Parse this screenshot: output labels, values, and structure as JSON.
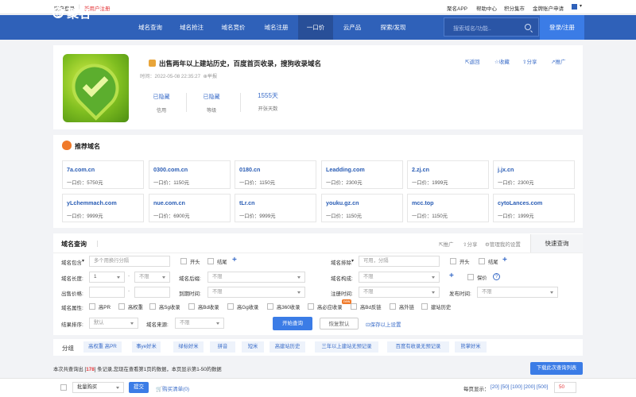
{
  "topbar": {
    "login": "账户登录",
    "register": "新用户注册",
    "app": "聚名APP",
    "help": "帮助中心",
    "points": "积分集市",
    "gold": "金牌账户申请"
  },
  "brand": {
    "name": "聚名"
  },
  "nav": [
    "域名查询",
    "域名抢注",
    "域名竞价",
    "域名注册",
    "一口价",
    "云产品",
    "探索/发现"
  ],
  "search": {
    "placeholder": "搜索域名/功能.."
  },
  "login_button": "登录/注册",
  "listing": {
    "title": "出售两年以上建站历史，百度首页收录，搜狗收录域名",
    "time": "时间：2022-05-08 22:35:27",
    "report": "举报",
    "stats": [
      {
        "value": "已隐藏",
        "label": "信用"
      },
      {
        "value": "已隐藏",
        "label": "等级"
      },
      {
        "value": "1555天",
        "label": "开张天数"
      }
    ],
    "actions": [
      "返回",
      "收藏",
      "分享",
      "推广"
    ]
  },
  "recommend": {
    "title": "推荐域名",
    "items": [
      {
        "domain": "7a.com.cn",
        "price": "一口价：5750元"
      },
      {
        "domain": "0300.com.cn",
        "price": "一口价：1150元"
      },
      {
        "domain": "0180.cn",
        "price": "一口价：1150元"
      },
      {
        "domain": "Leadding.com",
        "price": "一口价：2300元"
      },
      {
        "domain": "2.zj.cn",
        "price": "一口价：1999元"
      },
      {
        "domain": "j.jx.cn",
        "price": "一口价：2300元"
      },
      {
        "domain": "yLchemmach.com",
        "price": "一口价：9999元"
      },
      {
        "domain": "nue.com.cn",
        "price": "一口价：6900元"
      },
      {
        "domain": "tLr.cn",
        "price": "一口价：9999元"
      },
      {
        "domain": "youku.gz.cn",
        "price": "一口价：1150元"
      },
      {
        "domain": "mcc.top",
        "price": "一口价：1150元"
      },
      {
        "domain": "cytoLances.com",
        "price": "一口价：1999元"
      }
    ]
  },
  "query": {
    "title": "域名查询",
    "links": [
      "推广",
      "分享",
      "管理我的设置"
    ],
    "quick": "快速查询",
    "contains_label": "域名包含",
    "contains_ph": "多个用换行分隔",
    "exclude_label": "域名排除",
    "exclude_ph": "可用，分隔",
    "start": "开头",
    "end": "结尾",
    "length_label": "域名长度:",
    "length_from": "1",
    "length_to": "不限",
    "suffix_label": "域名后缀:",
    "suffix_val": "不限",
    "struct_label": "域名构成:",
    "struct_val": "不限",
    "deposit": "保价",
    "price_label": "出售价格:",
    "expire_label": "到期时间:",
    "expire_val": "不限",
    "regtime_label": "注册时间:",
    "regtime_val": "不限",
    "pubtime_label": "发布时间:",
    "pubtime_val": "不限",
    "attr_label": "域名属性:",
    "attrs": [
      "高PR",
      "高权重",
      "高Sg收录",
      "高Bd收录",
      "高Gg收录",
      "高360收录",
      "高必应收录",
      "高Bd反链",
      "高外链",
      "建站历史"
    ],
    "new_badge": "new",
    "sort_label": "结果排序:",
    "sort_val": "默认",
    "source_label": "域名来源:",
    "source_val": "不限",
    "submit": "开始查询",
    "reset": "恢复默认",
    "save": "保存以上设置"
  },
  "groups": {
    "label": "分组",
    "tags": [
      "高权重 高PR",
      "事ye好米",
      "绿标好米",
      "拼音",
      "短米",
      "高建站历史",
      "三年以上建站无预记录",
      "百度有收录无预记录",
      "熊掌好米"
    ]
  },
  "results": {
    "summary_pre": "本次共查询出 [",
    "count": "178",
    "summary_post": "] 条记录,您现在查看第1页的数据，本页显示第1-50的数据",
    "download": "下载此次查询列表"
  },
  "footer": {
    "bulk": "批量购买",
    "submit": "提交",
    "cart": "购买清单(0)",
    "per_page": "每页显示：",
    "sizes": "[20] [50] [100] [200] [500]",
    "per_input": "50"
  }
}
